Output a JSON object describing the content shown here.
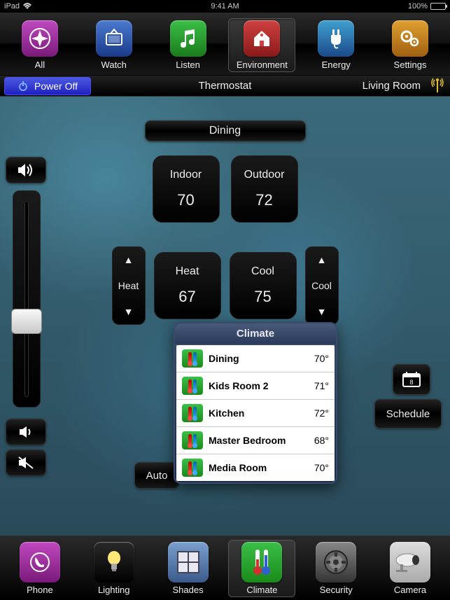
{
  "status": {
    "device": "iPad",
    "wifi": true,
    "time": "9:41 AM",
    "battery_pct": "100%"
  },
  "top_nav": {
    "items": [
      {
        "label": "All"
      },
      {
        "label": "Watch"
      },
      {
        "label": "Listen"
      },
      {
        "label": "Environment",
        "selected": true
      },
      {
        "label": "Energy"
      },
      {
        "label": "Settings"
      }
    ]
  },
  "sub_bar": {
    "power_label": "Power Off",
    "center_label": "Thermostat",
    "room_label": "Living Room"
  },
  "main": {
    "zone_name": "Dining",
    "indoor": {
      "label": "Indoor",
      "value": "70"
    },
    "outdoor": {
      "label": "Outdoor",
      "value": "72"
    },
    "heat": {
      "label": "Heat",
      "value": "67",
      "stepper_label": "Heat"
    },
    "cool": {
      "label": "Cool",
      "value": "75",
      "stepper_label": "Cool"
    },
    "auto_label": "Auto",
    "schedule_label": "Schedule",
    "calendar_day": "8"
  },
  "popover": {
    "title": "Climate",
    "rows": [
      {
        "name": "Dining",
        "temp": "70°"
      },
      {
        "name": "Kids Room 2",
        "temp": "71°"
      },
      {
        "name": "Kitchen",
        "temp": "72°"
      },
      {
        "name": "Master Bedroom",
        "temp": "68°"
      },
      {
        "name": "Media Room",
        "temp": "70°"
      }
    ]
  },
  "bottom_nav": {
    "items": [
      {
        "label": "Phone"
      },
      {
        "label": "Lighting"
      },
      {
        "label": "Shades"
      },
      {
        "label": "Climate",
        "selected": true
      },
      {
        "label": "Security"
      },
      {
        "label": "Camera"
      }
    ]
  }
}
